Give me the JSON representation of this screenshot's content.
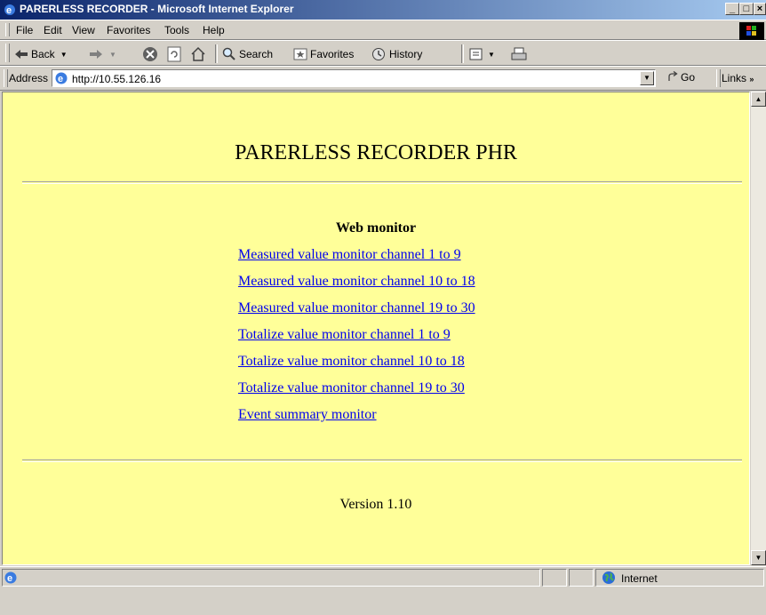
{
  "window": {
    "title": "PARERLESS RECORDER - Microsoft Internet Explorer",
    "min_label": "_",
    "max_label": "□",
    "close_label": "×"
  },
  "menu": {
    "file": "File",
    "edit": "Edit",
    "view": "View",
    "favorites": "Favorites",
    "tools": "Tools",
    "help": "Help"
  },
  "toolbar": {
    "back": "Back",
    "search": "Search",
    "favorites": "Favorites",
    "history": "History"
  },
  "address": {
    "label": "Address",
    "url": "http://10.55.126.16",
    "go": "Go",
    "links": "Links"
  },
  "page": {
    "title": "PARERLESS RECORDER PHR",
    "section_title": "Web monitor",
    "links": [
      "Measured value monitor channel 1 to 9",
      "Measured value monitor channel 10 to 18",
      "Measured value monitor channel 19 to 30",
      "Totalize value monitor channel 1 to 9",
      "Totalize value monitor channel 10 to 18",
      "Totalize value monitor channel 19 to 30",
      "Event summary monitor"
    ],
    "version": "Version 1.10"
  },
  "status": {
    "zone": "Internet"
  },
  "colors": {
    "page_bg": "#ffff99",
    "link": "#0000ee",
    "titlebar_start": "#0a246a",
    "titlebar_end": "#a6caf0"
  }
}
